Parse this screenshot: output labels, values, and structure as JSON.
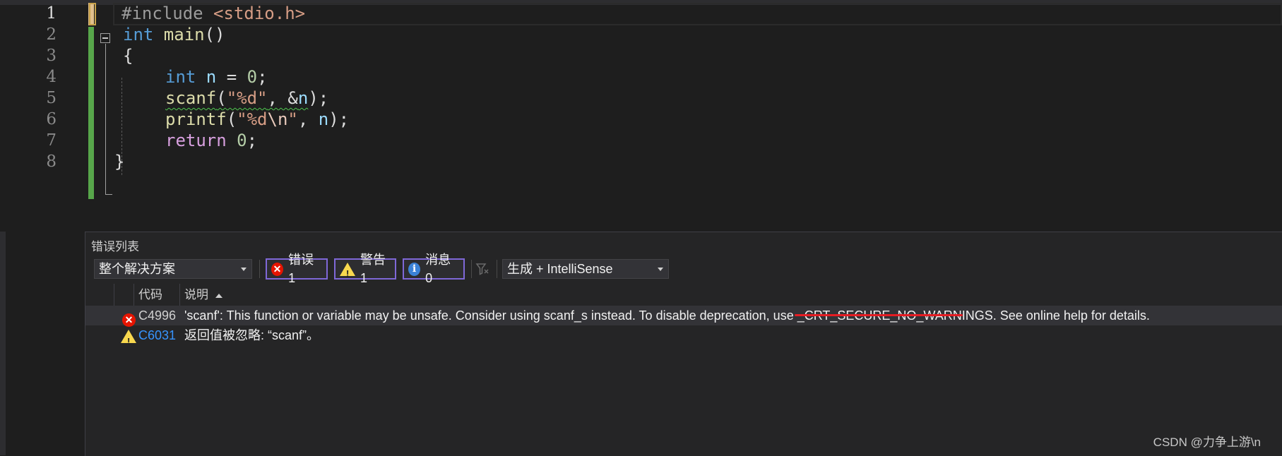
{
  "editor": {
    "line_numbers": [
      "1",
      "2",
      "3",
      "4",
      "5",
      "6",
      "7",
      "8"
    ],
    "lines": {
      "l1_hash": "#include ",
      "l1_header": "<stdio.h>",
      "l2_kw": "int",
      "l2_fn": " main",
      "l2_rest": "()",
      "l3": "{",
      "l4_kw": "int",
      "l4_var": " n",
      "l4_op": " = ",
      "l4_num": "0",
      "l4_end": ";",
      "l5_fn": "scanf",
      "l5_open": "(",
      "l5_str": "\"%d\"",
      "l5_mid": ", &",
      "l5_var": "n",
      "l5_end": ");",
      "l6_fn": "printf",
      "l6_open": "(",
      "l6_str1": "\"%d",
      "l6_esc": "\\n",
      "l6_str2": "\"",
      "l6_mid": ", ",
      "l6_var": "n",
      "l6_end": ");",
      "l7_kw": "return",
      "l7_sp": " ",
      "l7_num": "0",
      "l7_end": ";",
      "l8": "}"
    }
  },
  "error_list": {
    "title": "错误列表",
    "scope": "整个解决方案",
    "errors_label": "错误 1",
    "warnings_label": "警告 1",
    "messages_label": "消息 0",
    "build_filter": "生成 + IntelliSense",
    "columns": {
      "code": "代码",
      "description": "说明"
    },
    "rows": [
      {
        "code": "C4996",
        "description": "'scanf': This function or variable may be unsafe. Consider using scanf_s instead. To disable deprecation, use _CRT_SECURE_NO_WARNINGS. See online help for details."
      },
      {
        "code": "C6031",
        "description": "返回值被忽略: “scanf”。"
      }
    ]
  },
  "watermark": "CSDN @力争上游\\n",
  "colors": {
    "editor_bg": "#1e1e1e",
    "keyword": "#569cd6",
    "function": "#dcdcaa",
    "string": "#d69d85",
    "number": "#b5cea8",
    "error_red": "#e51400",
    "warning_yellow": "#f8d84e",
    "info_blue": "#3b82d6",
    "link_blue": "#3794ff",
    "filter_border": "#7f68d8",
    "annotation_underline": "#e51c23"
  },
  "icons": [
    "error-icon",
    "warning-icon",
    "info-icon",
    "clear-filter-icon",
    "fold-collapse-icon",
    "dropdown-arrow-icon",
    "sort-ascending-icon"
  ]
}
